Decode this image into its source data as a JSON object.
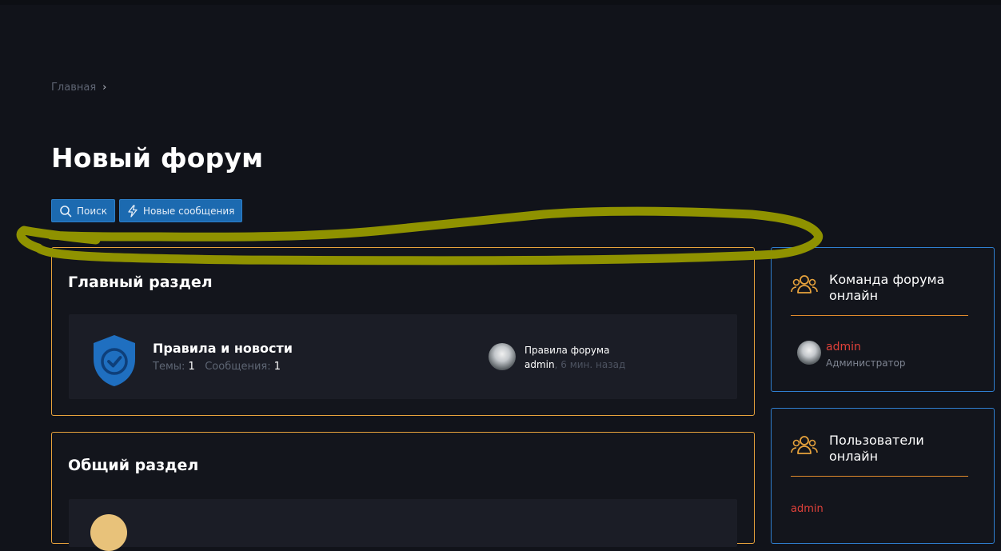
{
  "breadcrumb": {
    "home": "Главная"
  },
  "page": {
    "title": "Новый форум"
  },
  "actions": {
    "search": "Поиск",
    "new_posts": "Новые сообщения"
  },
  "sections": [
    {
      "title": "Главный раздел",
      "forum": {
        "name": "Правила и новости",
        "threads_label": "Темы:",
        "threads": "1",
        "messages_label": "Сообщения:",
        "messages": "1",
        "last_post_title": "Правила форума",
        "last_post_user": "admin",
        "last_post_time": ", 6 мин. назад"
      }
    },
    {
      "title": "Общий раздел"
    }
  ],
  "sidebar": {
    "staff": {
      "title": "Команда форума онлайн",
      "user": {
        "name": "admin",
        "role": "Администратор"
      }
    },
    "online": {
      "title": "Пользователи онлайн",
      "user": "admin"
    }
  },
  "colors": {
    "accent": "#e8a33c",
    "primary_button": "#1c6ab0",
    "sidebar_border": "#2f7fd0",
    "admin_name": "#e0413a",
    "annotation": "#8f9200"
  }
}
